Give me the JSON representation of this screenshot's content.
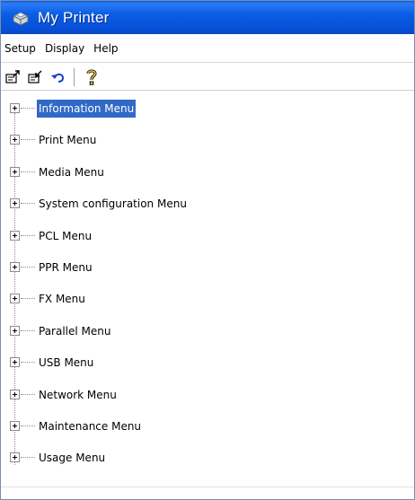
{
  "window": {
    "title": "My Printer",
    "icon": "printer-icon"
  },
  "menubar": {
    "items": [
      "Setup",
      "Display",
      "Help"
    ]
  },
  "toolbar": {
    "buttons": [
      {
        "name": "open-settings-icon"
      },
      {
        "name": "save-settings-icon"
      },
      {
        "name": "undo-icon"
      },
      {
        "name": "help-icon"
      }
    ]
  },
  "tree": {
    "items": [
      {
        "label": "Information Menu",
        "selected": true
      },
      {
        "label": "Print Menu",
        "selected": false
      },
      {
        "label": "Media Menu",
        "selected": false
      },
      {
        "label": "System configuration Menu",
        "selected": false
      },
      {
        "label": "PCL Menu",
        "selected": false
      },
      {
        "label": "PPR Menu",
        "selected": false
      },
      {
        "label": "FX Menu",
        "selected": false
      },
      {
        "label": "Parallel Menu",
        "selected": false
      },
      {
        "label": "USB Menu",
        "selected": false
      },
      {
        "label": "Network Menu",
        "selected": false
      },
      {
        "label": "Maintenance Menu",
        "selected": false
      },
      {
        "label": "Usage Menu",
        "selected": false
      }
    ]
  },
  "colors": {
    "titlebar": "#0a5de0",
    "selection": "#3169c6"
  }
}
